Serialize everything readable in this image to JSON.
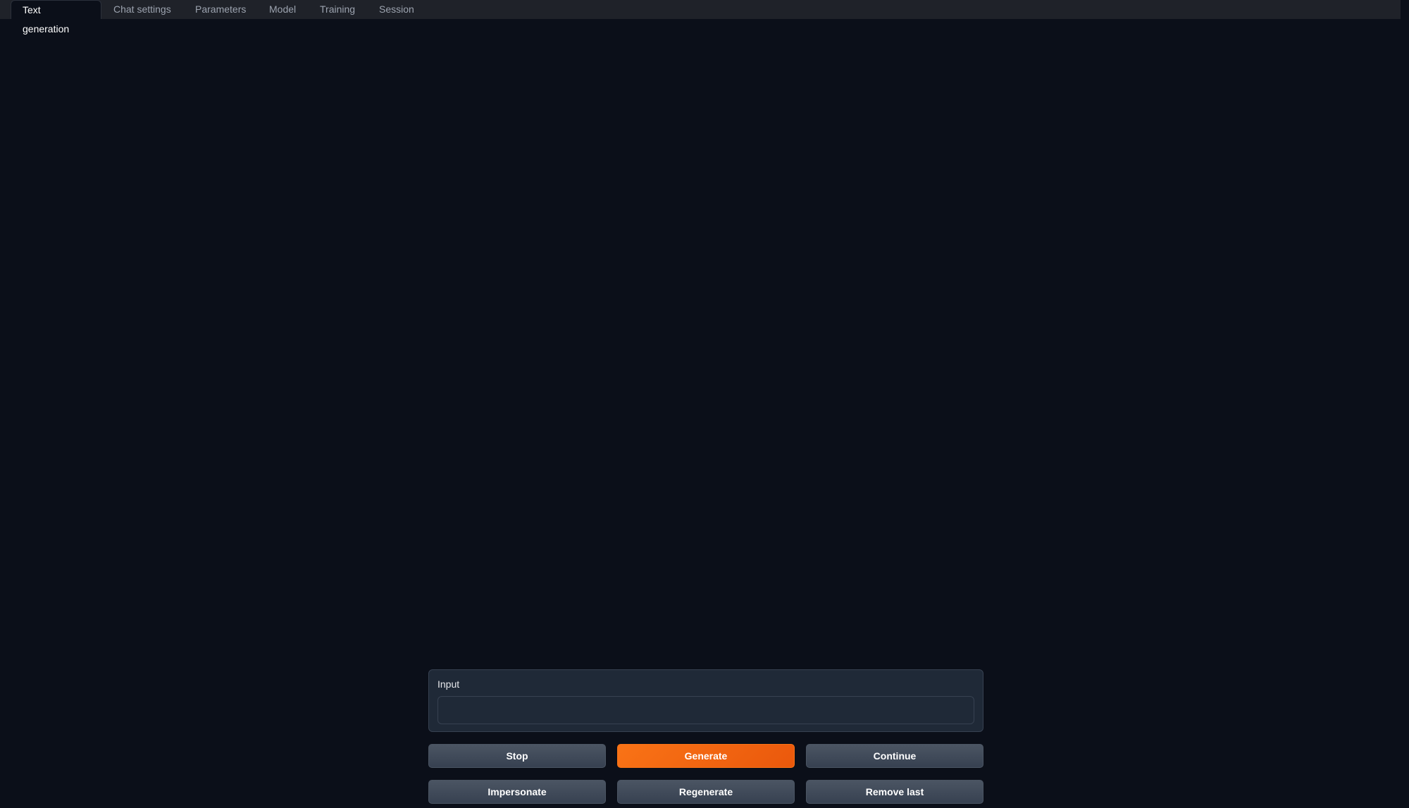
{
  "tabs": [
    {
      "label": "Text generation",
      "active": true
    },
    {
      "label": "Chat settings"
    },
    {
      "label": "Parameters"
    },
    {
      "label": "Model"
    },
    {
      "label": "Training"
    },
    {
      "label": "Session"
    }
  ],
  "input": {
    "label": "Input",
    "value": ""
  },
  "buttons": {
    "stop": "Stop",
    "generate": "Generate",
    "continue": "Continue",
    "impersonate": "Impersonate",
    "regenerate": "Regenerate",
    "remove_last": "Remove last"
  },
  "colors": {
    "accent": "#f97316",
    "background": "#0b0f19",
    "panel": "#1f2937"
  }
}
